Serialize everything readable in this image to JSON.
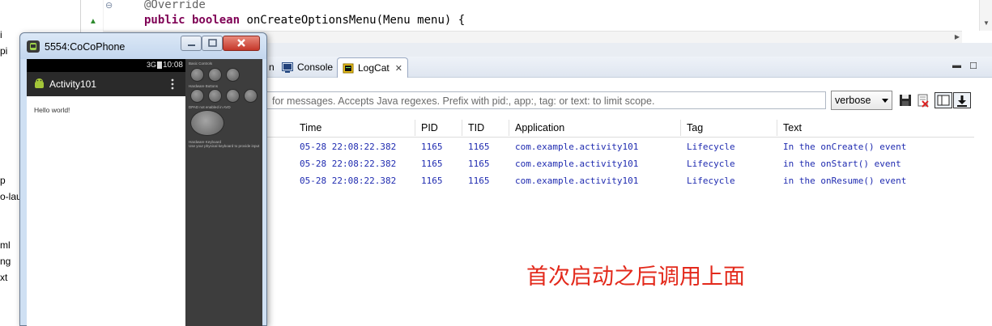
{
  "left_strip": {
    "items": [
      "i",
      "pi",
      "p",
      "o-lau",
      "ml",
      "ng",
      "xt"
    ]
  },
  "editor": {
    "annotation": "@Override",
    "line2_kw": "public boolean",
    "line2_rest": " onCreateOptionsMenu(Menu menu) {"
  },
  "views": {
    "tabs": [
      {
        "label": "n"
      },
      {
        "label": "Console"
      },
      {
        "label": "LogCat"
      }
    ]
  },
  "logcat": {
    "filter_placeholder": "for messages. Accepts Java regexes. Prefix with pid:, app:, tag: or text: to limit scope.",
    "level": "verbose",
    "columns": [
      "Time",
      "PID",
      "TID",
      "Application",
      "Tag",
      "Text"
    ],
    "rows": [
      {
        "time": "05-28 22:08:22.382",
        "pid": "1165",
        "tid": "1165",
        "app": "com.example.activity101",
        "tag": "Lifecycle",
        "text": "In the onCreate() event"
      },
      {
        "time": "05-28 22:08:22.382",
        "pid": "1165",
        "tid": "1165",
        "app": "com.example.activity101",
        "tag": "Lifecycle",
        "text": "in the onStart() event"
      },
      {
        "time": "05-28 22:08:22.382",
        "pid": "1165",
        "tid": "1165",
        "app": "com.example.activity101",
        "tag": "Lifecycle",
        "text": "in the onResume() event"
      }
    ],
    "row_color": "#1f2bb0"
  },
  "note": {
    "text": "首次启动之后调用上面",
    "color": "#e3291b"
  },
  "emulator": {
    "title": "5554:CoCoPhone",
    "status_signal": "3G",
    "status_time": "10:08",
    "app_title": "Activity101",
    "content_text": "Hello world!",
    "panel": {
      "basic_controls": "Basic Controls",
      "hardware_buttons": "Hardware Buttons",
      "dpad_label": "DPAD not enabled in AVD",
      "keyboard_label": "Hardware Keyboard",
      "keyboard_hint": "Use your physical keyboard to provide input"
    }
  }
}
